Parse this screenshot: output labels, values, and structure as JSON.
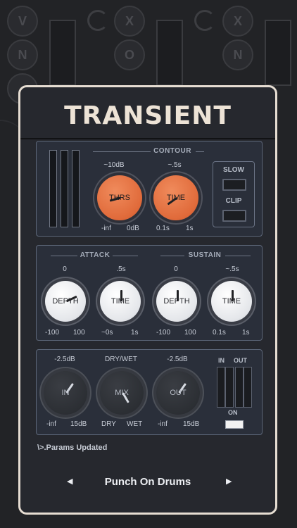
{
  "app": {
    "title": "TRANSIENT"
  },
  "background": {
    "glyphs": [
      "V",
      "N",
      "X",
      "O",
      "X",
      "N"
    ]
  },
  "contour": {
    "label": "CONTOUR",
    "thrs": {
      "label": "THRS",
      "value": "~10dB",
      "min": "-inf",
      "max": "0dB"
    },
    "time": {
      "label": "TIME",
      "value": "~.5s",
      "min": "0.1s",
      "max": "1s"
    },
    "slow_label": "SLOW",
    "clip_label": "CLIP"
  },
  "attack": {
    "label": "ATTACK",
    "depth": {
      "label": "DEPTH",
      "value": "0",
      "min": "-100",
      "max": "100"
    },
    "time": {
      "label": "TIME",
      "value": ".5s",
      "min": "~0s",
      "max": "1s"
    }
  },
  "sustain": {
    "label": "SUSTAIN",
    "depth": {
      "label": "DEPTH",
      "value": "0",
      "min": "-100",
      "max": "100"
    },
    "time": {
      "label": "TIME",
      "value": "~.5s",
      "min": "0.1s",
      "max": "1s"
    }
  },
  "output": {
    "in": {
      "label": "IN",
      "value": "-2.5dB",
      "min": "-inf",
      "max": "15dB"
    },
    "mix": {
      "label": "MIX",
      "value": "DRY/WET",
      "min": "DRY",
      "max": "WET"
    },
    "out": {
      "label": "OUT",
      "value": "-2.5dB",
      "min": "-inf",
      "max": "15dB"
    },
    "meter_in_label": "IN",
    "meter_out_label": "OUT",
    "on_label": "ON"
  },
  "status": {
    "text": "\\>.Params Updated"
  },
  "preset": {
    "name": "Punch On Drums",
    "prev_icon": "◀",
    "next_icon": "▶"
  },
  "colors": {
    "accent": "#e5703f",
    "frame": "#e6ddd2",
    "panel": "#26282e"
  }
}
